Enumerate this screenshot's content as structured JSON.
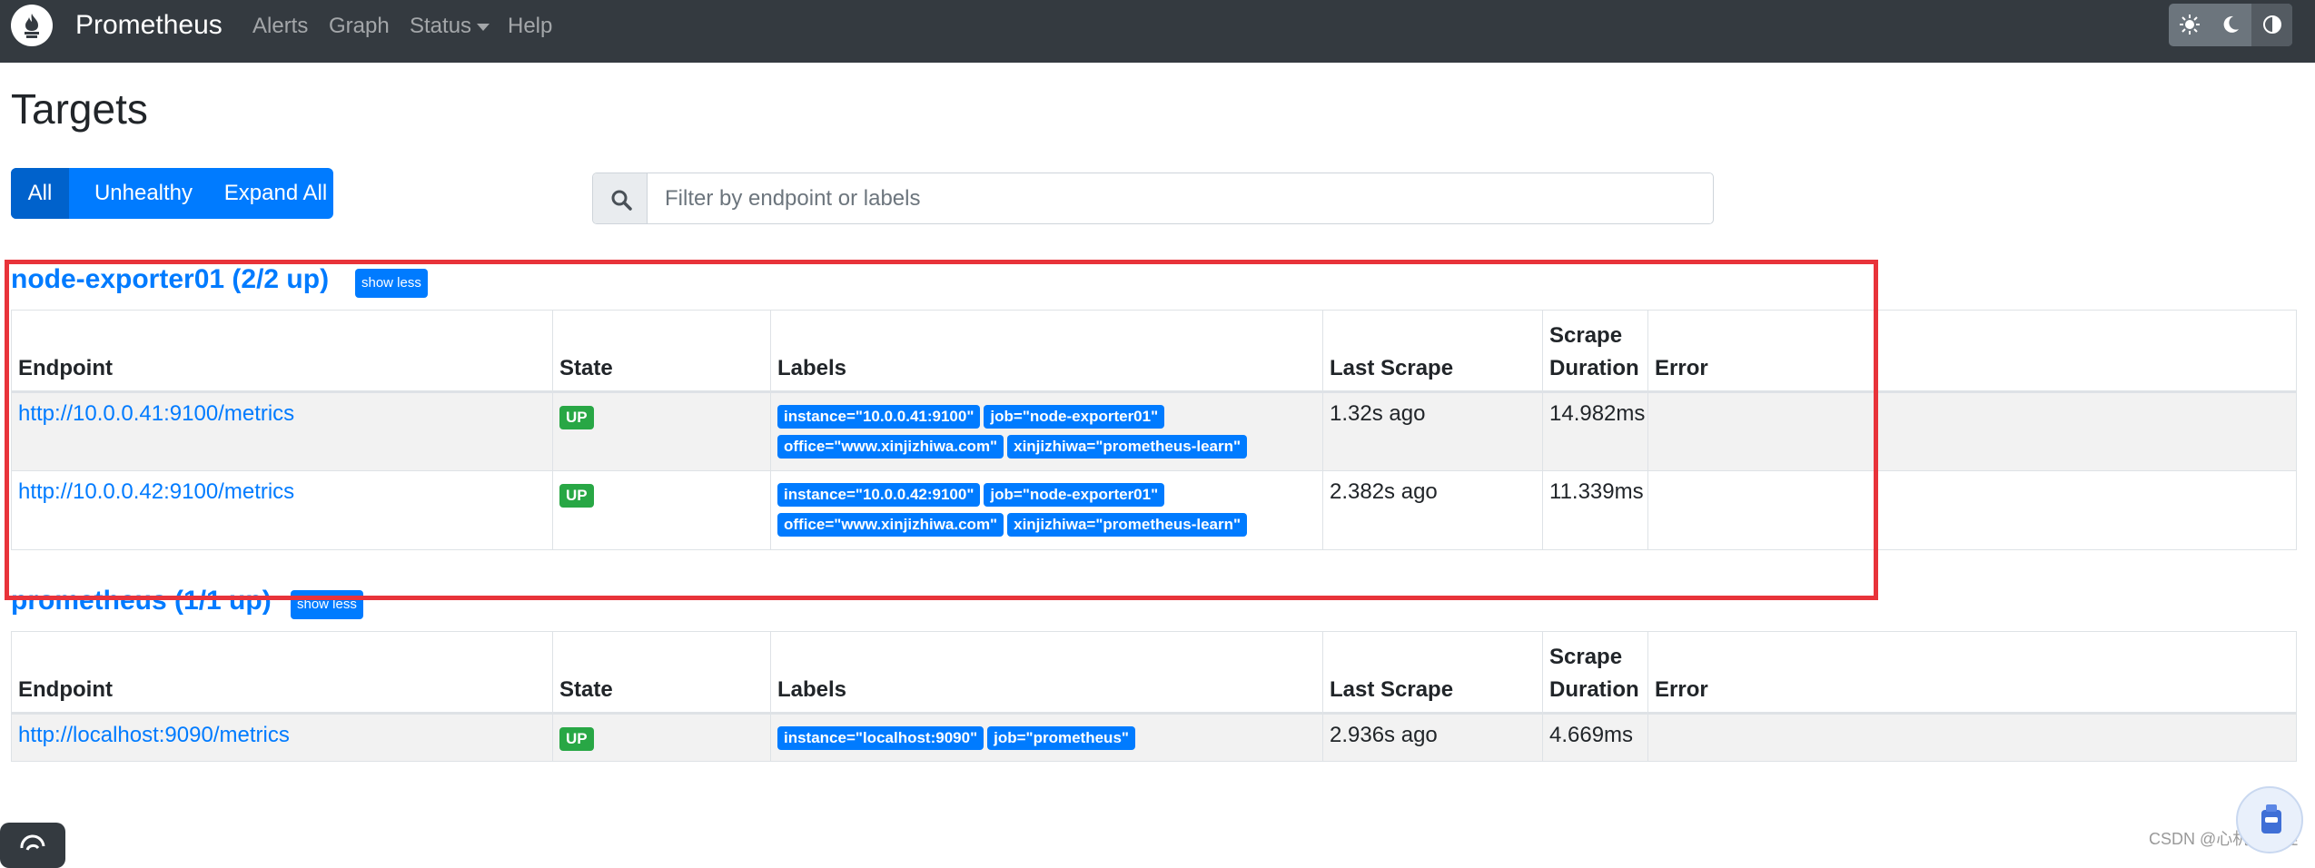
{
  "navbar": {
    "brand": "Prometheus",
    "items": [
      {
        "label": "Alerts"
      },
      {
        "label": "Graph"
      },
      {
        "label": "Status"
      },
      {
        "label": "Help"
      }
    ],
    "theme_buttons": [
      "sun-icon",
      "moon-icon",
      "half-circle-icon"
    ]
  },
  "page": {
    "title": "Targets"
  },
  "filters": {
    "all": "All",
    "unhealthy": "Unhealthy",
    "expand_all": "Expand All"
  },
  "search": {
    "placeholder": "Filter by endpoint or labels"
  },
  "table_headers": {
    "endpoint": "Endpoint",
    "state": "State",
    "labels": "Labels",
    "last_scrape": "Last Scrape",
    "scrape_duration_line1": "Scrape",
    "scrape_duration_line2": "Duration",
    "error": "Error"
  },
  "pools": [
    {
      "title": "node-exporter01 (2/2 up)",
      "toggle": "show less",
      "rows": [
        {
          "endpoint": "http://10.0.0.41:9100/metrics",
          "state": "UP",
          "labels": [
            "instance=\"10.0.0.41:9100\"",
            "job=\"node-exporter01\"",
            "office=\"www.xinjizhiwa.com\"",
            "xinjizhiwa=\"prometheus-learn\""
          ],
          "last_scrape": "1.32s ago",
          "scrape_duration": "14.982ms",
          "error": ""
        },
        {
          "endpoint": "http://10.0.0.42:9100/metrics",
          "state": "UP",
          "labels": [
            "instance=\"10.0.0.42:9100\"",
            "job=\"node-exporter01\"",
            "office=\"www.xinjizhiwa.com\"",
            "xinjizhiwa=\"prometheus-learn\""
          ],
          "last_scrape": "2.382s ago",
          "scrape_duration": "11.339ms",
          "error": ""
        }
      ]
    },
    {
      "title": "prometheus (1/1 up)",
      "toggle": "show less",
      "rows": [
        {
          "endpoint": "http://localhost:9090/metrics",
          "state": "UP",
          "labels": [
            "instance=\"localhost:9090\"",
            "job=\"prometheus\""
          ],
          "last_scrape": "2.936s ago",
          "scrape_duration": "4.669ms",
          "error": ""
        }
      ]
    }
  ],
  "watermark": "CSDN @心机の之蛙",
  "colors": {
    "navbar": "#343a40",
    "primary": "#007bff",
    "success": "#28a745",
    "highlight": "#e8333a"
  }
}
